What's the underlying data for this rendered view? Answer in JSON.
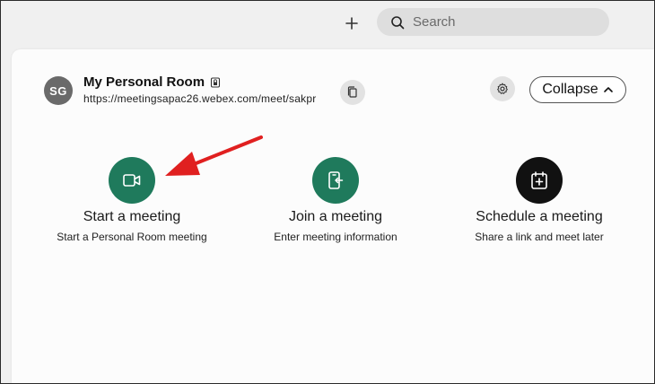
{
  "toolbar": {
    "add_icon": "plus-icon",
    "search": {
      "placeholder": "Search",
      "value": "",
      "icon": "search-icon"
    }
  },
  "room": {
    "avatar_initials": "SG",
    "title": "My Personal Room",
    "url": "https://meetingsapac26.webex.com/meet/sakpr",
    "lock_icon": "lock-icon",
    "copy_icon": "copy-icon",
    "settings_icon": "gear-icon",
    "collapse_label": "Collapse",
    "collapse_icon": "chevron-up-icon"
  },
  "actions": [
    {
      "title": "Start a meeting",
      "subtitle": "Start a Personal Room meeting",
      "icon": "video-camera-icon",
      "color": "#1f7a5c"
    },
    {
      "title": "Join a meeting",
      "subtitle": "Enter meeting information",
      "icon": "join-door-icon",
      "color": "#1f7a5c"
    },
    {
      "title": "Schedule a meeting",
      "subtitle": "Share a link and meet later",
      "icon": "calendar-add-icon",
      "color": "#111111"
    }
  ],
  "annotation": {
    "arrow_color": "#e02020"
  },
  "colors": {
    "accent_green": "#1f7a5c",
    "panel_bg": "#fcfcfc",
    "app_bg": "#f0f0f0"
  }
}
